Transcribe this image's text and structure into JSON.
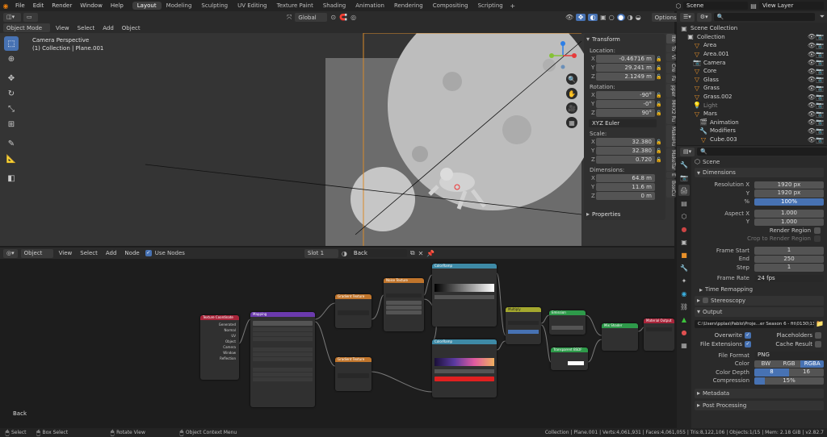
{
  "menu": [
    "File",
    "Edit",
    "Render",
    "Window",
    "Help"
  ],
  "workspaces": [
    "Layout",
    "Modeling",
    "Sculpting",
    "UV Editing",
    "Texture Paint",
    "Shading",
    "Animation",
    "Rendering",
    "Compositing",
    "Scripting"
  ],
  "scene_name": "Scene",
  "view_layer": "View Layer",
  "viewport": {
    "mode": "Object Mode",
    "menus": [
      "View",
      "Select",
      "Add",
      "Object"
    ],
    "transform_orientation": "Global",
    "options": "Options",
    "overlay_line1": "Camera Perspective",
    "overlay_line2": "(1) Collection | Plane.001"
  },
  "npanel": {
    "title": "Transform",
    "location_label": "Location:",
    "location": {
      "x": "-0.46716 m",
      "y": "29.241 m",
      "z": "2.1249 m"
    },
    "rotation_label": "Rotation:",
    "rotation": {
      "x": "-90°",
      "y": "-0°",
      "z": "90°"
    },
    "euler": "XYZ Euler",
    "scale_label": "Scale:",
    "scale": {
      "x": "32.380",
      "y": "32.380",
      "z": "0.720"
    },
    "dimensions_label": "Dimensions:",
    "dimensions": {
      "x": "64.8 m",
      "y": "11.6 m",
      "z": "0 m"
    },
    "properties": "Properties",
    "tabs": [
      "Ite",
      "To",
      "Vi",
      "Cre",
      "Fa",
      "pper",
      "MHX2 Ru",
      "MakeHu",
      "MakeTar",
      "E",
      "BoxCu"
    ]
  },
  "outliner": {
    "title": "Scene Collection",
    "items": [
      {
        "name": "Collection",
        "indent": 1
      },
      {
        "name": "Area",
        "indent": 2
      },
      {
        "name": "Area.001",
        "indent": 2
      },
      {
        "name": "Camera",
        "indent": 2
      },
      {
        "name": "Core",
        "indent": 2
      },
      {
        "name": "Glass",
        "indent": 2
      },
      {
        "name": "Grass",
        "indent": 2
      },
      {
        "name": "Grass.002",
        "indent": 2
      },
      {
        "name": "Light",
        "indent": 2
      },
      {
        "name": "Mars",
        "indent": 2
      },
      {
        "name": "Animation",
        "indent": 3
      },
      {
        "name": "Modifiers",
        "indent": 3
      },
      {
        "name": "Cube.003",
        "indent": 3
      }
    ]
  },
  "properties": {
    "scene": "Scene",
    "dimensions": "Dimensions",
    "res_x_label": "Resolution X",
    "res_x": "1920 px",
    "res_y_label": "Y",
    "res_y": "1920 px",
    "pct_label": "%",
    "pct": "100%",
    "aspect_x_label": "Aspect X",
    "aspect_x": "1.000",
    "aspect_y_label": "Y",
    "aspect_y": "1.000",
    "render_region": "Render Region",
    "crop": "Crop to Render Region",
    "frame_start_label": "Frame Start",
    "frame_start": "1",
    "end_label": "End",
    "end": "250",
    "step_label": "Step",
    "step": "1",
    "frame_rate_label": "Frame Rate",
    "frame_rate": "24 fps",
    "time_remapping": "Time Remapping",
    "stereoscopy": "Stereoscopy",
    "output": "Output",
    "path": "C:\\Users\\pplas\\Pablo\\Proje...er Season 6 - fit\\0130\\130",
    "overwrite": "Overwrite",
    "placeholders": "Placeholders",
    "file_extensions": "File Extensions",
    "cache_result": "Cache Result",
    "file_format_label": "File Format",
    "file_format": "PNG",
    "color_label": "Color",
    "color_opts": [
      "BW",
      "RGB",
      "RGBA"
    ],
    "color_depth_label": "Color Depth",
    "depth_opts": [
      "8",
      "16"
    ],
    "compression_label": "Compression",
    "compression": "15%",
    "metadata": "Metadata",
    "post_processing": "Post Processing"
  },
  "node_editor": {
    "type": "Object",
    "menus": [
      "View",
      "Select",
      "Add",
      "Node"
    ],
    "use_nodes": "Use Nodes",
    "slot": "Slot 1",
    "material": "Back",
    "label": "Back",
    "nodes": {
      "texcoord": "Texture Coordinate",
      "mapping": "Mapping",
      "gradient1": "Gradient Texture",
      "gradient2": "Gradient Texture",
      "noise": "Noise Texture",
      "ramp1": "ColorRamp",
      "ramp2": "ColorRamp",
      "multiply": "Multiply",
      "emission": "Emission",
      "transparent": "Transparent BSDF",
      "mix": "Mix Shader",
      "output": "Material Output"
    }
  },
  "status": {
    "select": "Select",
    "box_select": "Box Select",
    "rotate": "Rotate View",
    "context": "Object Context Menu",
    "stats": "Collection | Plane.001 | Verts:4,061,931 | Faces:4,061,055 | Tris:8,122,106 | Objects:1/15 | Mem: 2.18 GiB | v2.82.7"
  },
  "colors": {
    "accent": "#4772b3",
    "bg": "#1d1d1d",
    "panel": "#303030"
  }
}
